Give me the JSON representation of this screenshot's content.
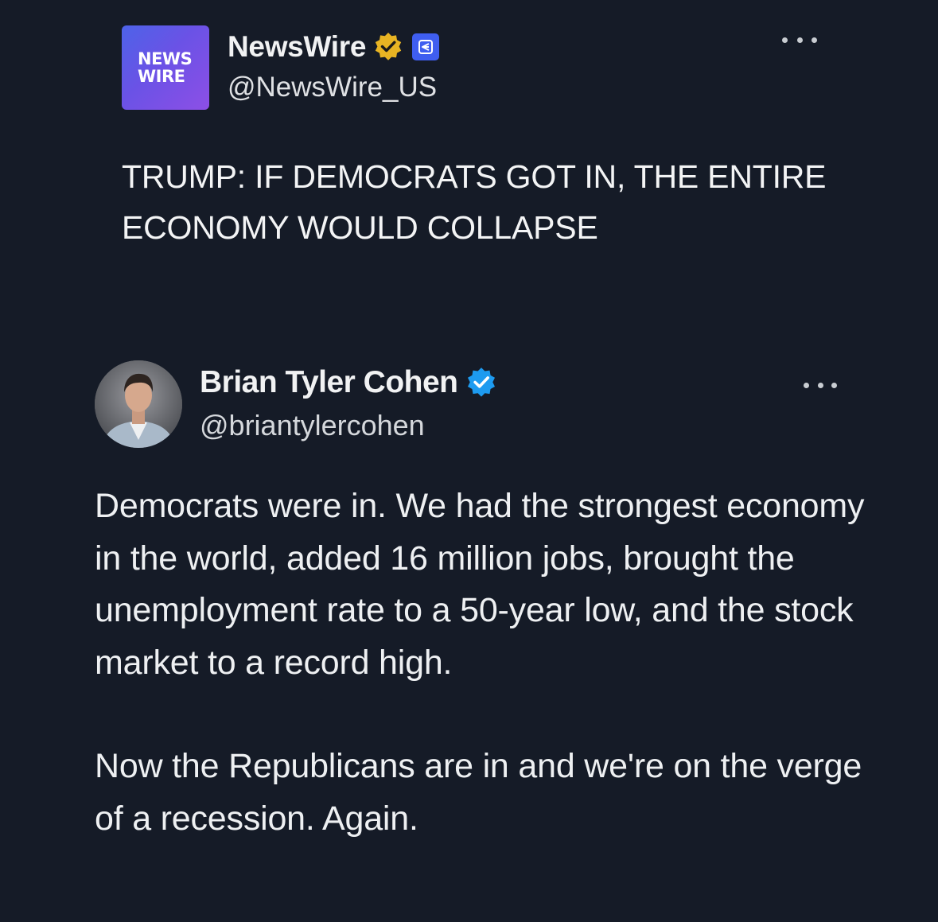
{
  "quoted_tweet": {
    "avatar": {
      "line1": "NEWS",
      "line2": "WIRE",
      "colors": [
        "#4d63e8",
        "#8d4fe6"
      ]
    },
    "display_name": "NewsWire",
    "verified_badge": "gold-verified-icon",
    "affiliate_badge": "affiliate-icon",
    "handle": "@NewsWire_US",
    "menu_icon": "more-options-icon",
    "headline": "TRUMP: IF DEMOCRATS GOT IN, THE ENTIRE ECONOMY WOULD COLLAPSE"
  },
  "reply_tweet": {
    "avatar": "profile-photo",
    "display_name": "Brian Tyler Cohen",
    "verified_badge": "blue-verified-icon",
    "handle": "@briantylercohen",
    "menu_icon": "more-options-icon",
    "paragraph1": "Democrats were in. We had the strongest economy in the world, added 16 million jobs, brought the unemployment rate to a 50-year low, and the stock market to a record high.",
    "paragraph2": "Now the Republicans are in and we're on the verge of a recession. Again."
  },
  "colors": {
    "background": "#151b27",
    "gold_badge": "#e8b423",
    "blue_badge": "#1d9bf0",
    "affiliate_badge": "#3f5ef0"
  }
}
